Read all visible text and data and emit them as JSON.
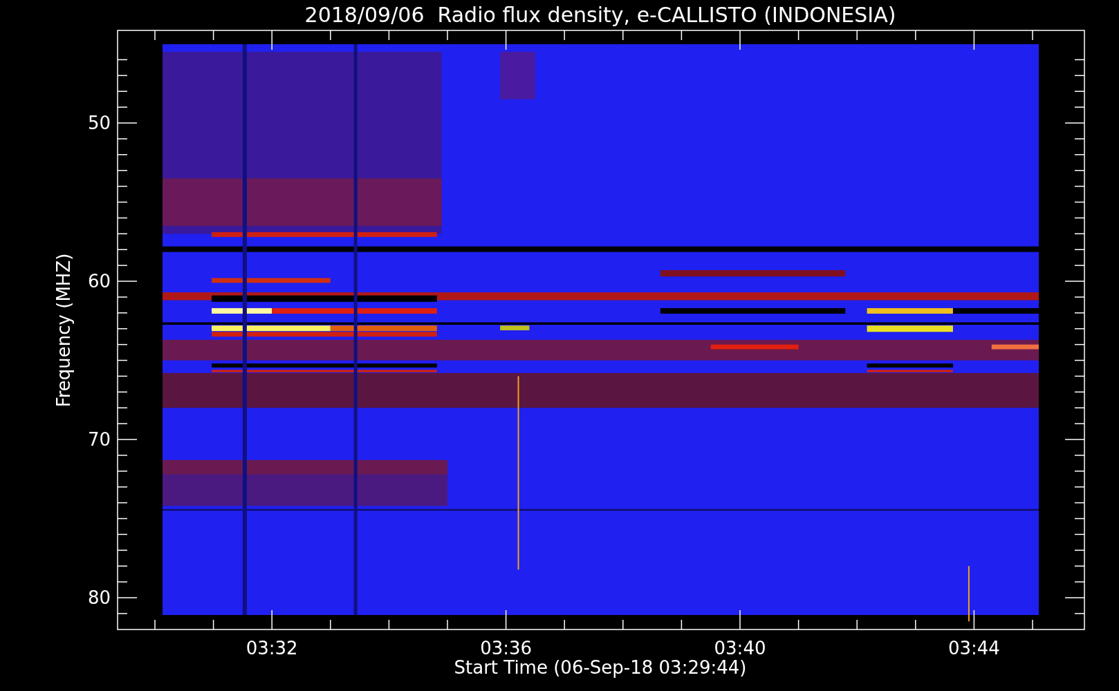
{
  "plot": {
    "title": "2018/09/06  Radio flux density, e-CALLISTO (INDONESIA)",
    "xlabel": "Start Time (06-Sep-18 03:29:44)",
    "ylabel": "Frequency (MHZ)",
    "xticks": [
      "03:32",
      "03:36",
      "03:40",
      "03:44"
    ],
    "yticks": [
      "50",
      "60",
      "70",
      "80"
    ]
  }
}
